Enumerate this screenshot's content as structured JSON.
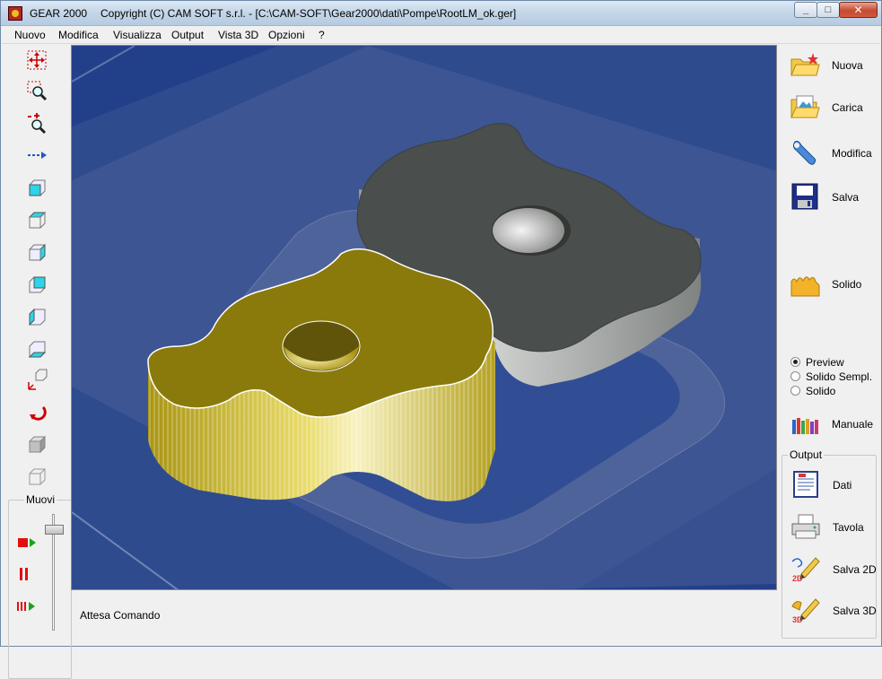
{
  "window": {
    "app_name": "GEAR 2000",
    "title": "Copyright (C)  CAM SOFT s.r.l. - [C:\\CAM-SOFT\\Gear2000\\dati\\Pompe\\RootLM_ok.ger]",
    "controls": [
      "minimize-icon",
      "maximize-icon",
      "close-icon"
    ]
  },
  "menu": [
    "Nuovo",
    "Modifica",
    "Visualizza",
    "Output",
    "Vista 3D",
    "Opzioni",
    "?"
  ],
  "left_toolbar": {
    "tools": [
      "pan-icon",
      "zoom-window-icon",
      "zoom-in-out-icon",
      "move-arrow-icon",
      "view-cube-front-icon",
      "view-cube-top-icon",
      "view-cube-right-icon",
      "view-cube-left-icon",
      "view-cube-back-icon",
      "view-cube-bottom-icon",
      "axes-icon",
      "rotate-icon",
      "solid-cube-icon",
      "wire-cube-icon"
    ],
    "move_group": {
      "label": "Muovi",
      "buttons": [
        "record-icon",
        "pause-icon",
        "play-icon"
      ]
    }
  },
  "status": {
    "text": "Attesa Comando"
  },
  "right_panel": {
    "buttons": [
      {
        "label": "Nuova",
        "icon": "new-folder-icon"
      },
      {
        "label": "Carica",
        "icon": "open-folder-icon"
      },
      {
        "label": "Modifica",
        "icon": "wrench-icon"
      },
      {
        "label": "Salva",
        "icon": "floppy-icon"
      },
      {
        "label": "Solido",
        "icon": "gear-solid-icon"
      }
    ],
    "render_mode": {
      "options": [
        "Preview",
        "Solido Sempl.",
        "Solido"
      ],
      "selected": "Preview"
    },
    "manual": {
      "label": "Manuale",
      "icon": "books-icon"
    },
    "output_group": {
      "label": "Output",
      "buttons": [
        {
          "label": "Dati",
          "icon": "document-icon"
        },
        {
          "label": "Tavola",
          "icon": "printer-icon"
        },
        {
          "label": "Salva 2D",
          "icon": "pencil-2d-icon"
        },
        {
          "label": "Salva 3D",
          "icon": "pencil-3d-icon"
        }
      ]
    }
  },
  "colors": {
    "viewport_background": "#223f8a",
    "rotor_front": "#8a7a0c",
    "rotor_back": "#4a4e4c"
  }
}
